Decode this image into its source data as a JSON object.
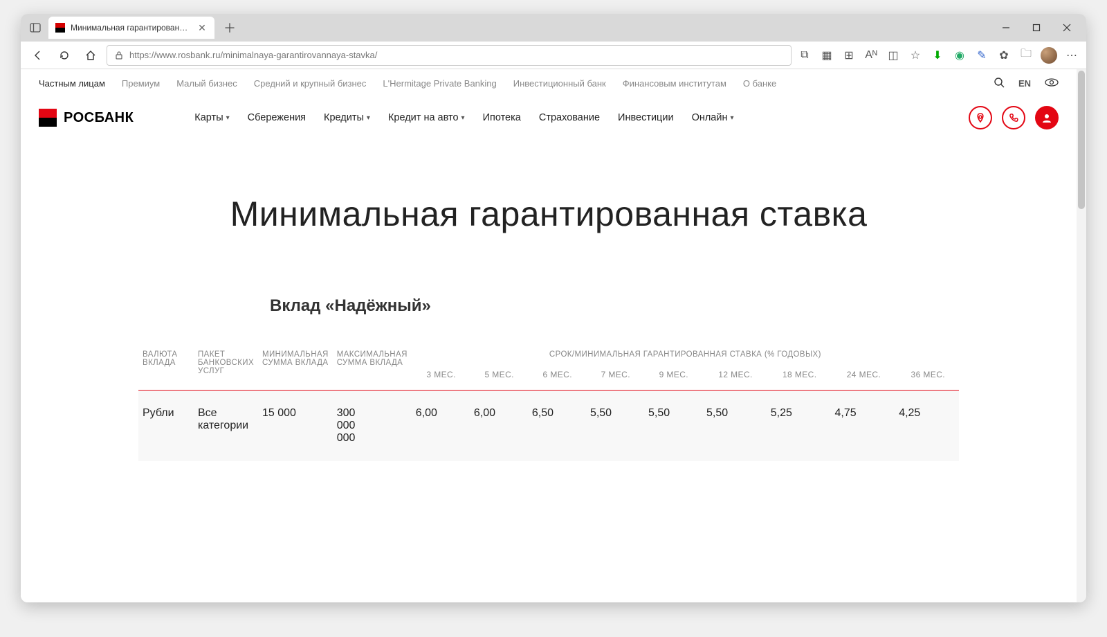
{
  "browser": {
    "tab_title": "Минимальная гарантированная",
    "url": "https://www.rosbank.ru/minimalnaya-garantirovannaya-stavka/"
  },
  "topnav": {
    "items": [
      "Частным лицам",
      "Премиум",
      "Малый бизнес",
      "Средний и крупный бизнес",
      "L'Hermitage Private Banking",
      "Инвестиционный банк",
      "Финансовым институтам",
      "О банке"
    ],
    "lang": "EN"
  },
  "logo_text": "РОСБАНК",
  "menu": {
    "items": [
      {
        "label": "Карты",
        "chev": true
      },
      {
        "label": "Сбережения",
        "chev": false
      },
      {
        "label": "Кредиты",
        "chev": true
      },
      {
        "label": "Кредит на авто",
        "chev": true
      },
      {
        "label": "Ипотека",
        "chev": false
      },
      {
        "label": "Страхование",
        "chev": false
      },
      {
        "label": "Инвестиции",
        "chev": false
      },
      {
        "label": "Онлайн",
        "chev": true
      }
    ]
  },
  "page_title": "Минимальная гарантированная ставка",
  "section_title": "Вклад «Надёжный»",
  "table": {
    "headers_top": [
      "ВАЛЮТА ВКЛАДА",
      "ПАКЕТ БАНКОВСКИХ УСЛУГ",
      "МИНИМАЛЬНАЯ СУММА ВКЛАДА",
      "МАКСИМАЛЬНАЯ СУММА ВКЛАДА"
    ],
    "header_span": "СРОК/МИНИМАЛЬНАЯ ГАРАНТИРОВАННАЯ СТАВКА (% ГОДОВЫХ)",
    "months": [
      "3 МЕС.",
      "5 МЕС.",
      "6 МЕС.",
      "7 МЕС.",
      "9 МЕС.",
      "12 МЕС.",
      "18 МЕС.",
      "24 МЕС.",
      "36 МЕС."
    ],
    "row": {
      "currency": "Рубли",
      "package": "Все категории",
      "min_sum": "15 000",
      "max_sum": "300 000 000",
      "rates": [
        "6,00",
        "6,00",
        "6,50",
        "5,50",
        "5,50",
        "5,50",
        "5,25",
        "4,75",
        "4,25"
      ]
    }
  },
  "chart_data": {
    "type": "table",
    "title": "Вклад «Надёжный» — Минимальная гарантированная ставка (% годовых)",
    "columns": [
      "ВАЛЮТА ВКЛАДА",
      "ПАКЕТ БАНКОВСКИХ УСЛУГ",
      "МИНИМАЛЬНАЯ СУММА ВКЛАДА",
      "МАКСИМАЛЬНАЯ СУММА ВКЛАДА",
      "3 МЕС.",
      "5 МЕС.",
      "6 МЕС.",
      "7 МЕС.",
      "9 МЕС.",
      "12 МЕС.",
      "18 МЕС.",
      "24 МЕС.",
      "36 МЕС."
    ],
    "rows": [
      [
        "Рубли",
        "Все категории",
        "15 000",
        "300 000 000",
        6.0,
        6.0,
        6.5,
        5.5,
        5.5,
        5.5,
        5.25,
        4.75,
        4.25
      ]
    ]
  }
}
